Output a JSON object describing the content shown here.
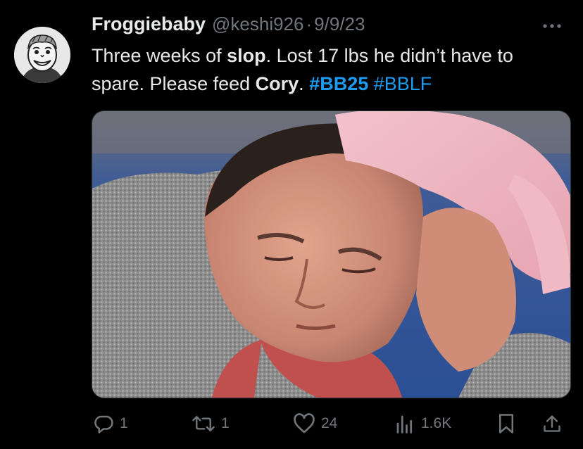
{
  "tweet": {
    "display_name": "Froggiebaby",
    "handle": "@keshi926",
    "separator": "·",
    "date": "9/9/23",
    "text": {
      "t1": "Three weeks of ",
      "b1": "slop",
      "t2": ". Lost 17 lbs he didn’t have to spare. Please feed ",
      "b2": "Cory",
      "t3": ". ",
      "hashtag1": "#BB25",
      "hashtag2": "#BBLF"
    },
    "media_description_icon": "photo"
  },
  "actions": {
    "replies": "1",
    "retweets": "1",
    "likes": "24",
    "views": "1.6K"
  },
  "colors": {
    "background": "#000000",
    "text": "#e7e9ea",
    "muted": "#71767b",
    "hashtag": "#1d9bf0"
  },
  "icons": [
    "more-icon",
    "reply-icon",
    "retweet-icon",
    "like-icon",
    "views-icon",
    "bookmark-icon",
    "share-icon"
  ]
}
